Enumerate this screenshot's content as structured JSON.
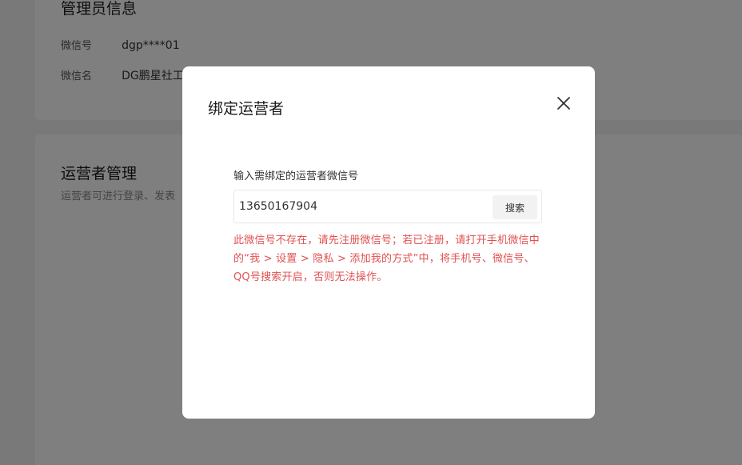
{
  "background": {
    "admin_section": {
      "title": "管理员信息",
      "rows": [
        {
          "label": "微信号",
          "value": "dgp****01"
        },
        {
          "label": "微信名",
          "value": "DG鹏星社工"
        }
      ]
    },
    "operator_section": {
      "title": "运营者管理",
      "description": "运营者可进行登录、发表"
    }
  },
  "dialog": {
    "title": "绑定运营者",
    "close_icon": "close-icon",
    "field_label": "输入需绑定的运营者微信号",
    "search_value": "13650167904",
    "search_button": "搜索",
    "error_message": "此微信号不存在，请先注册微信号；若已注册，请打开手机微信中的“我 > 设置 > 隐私 > 添加我的方式”中，将手机号、微信号、QQ号搜索开启，否则无法操作。"
  },
  "colors": {
    "error": "#e15151",
    "overlay": "rgba(0,0,0,0.5)"
  }
}
